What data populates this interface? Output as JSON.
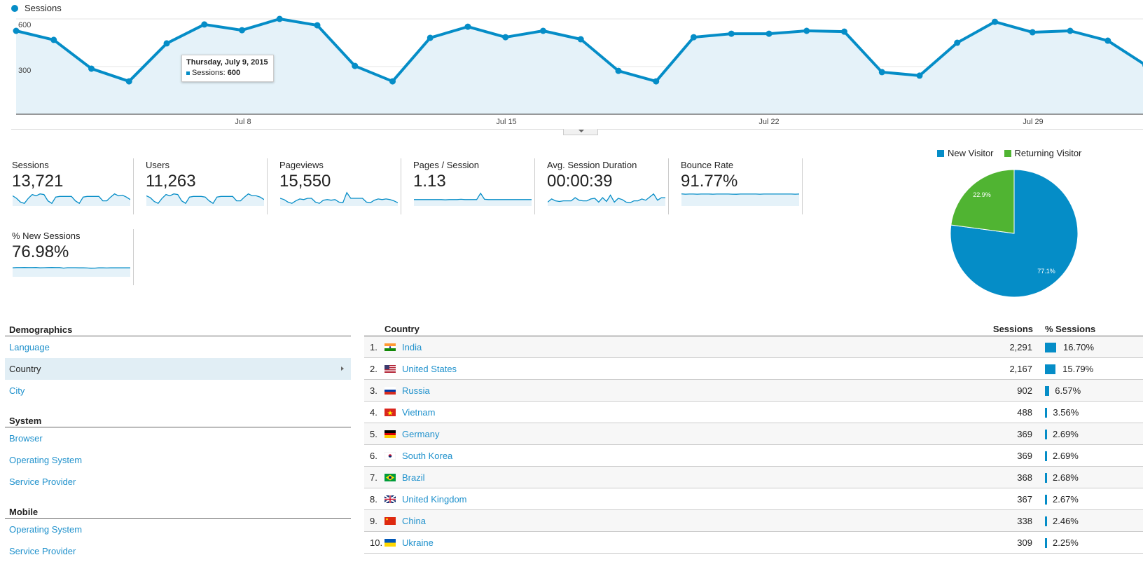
{
  "main_chart": {
    "legend_label": "Sessions",
    "y_ticks": [
      "600",
      "300"
    ],
    "x_ticks": [
      "Jul 8",
      "Jul 15",
      "Jul 22",
      "Jul 29"
    ],
    "tooltip": {
      "title": "Thursday, July 9, 2015",
      "metric": "Sessions:",
      "value": "600"
    }
  },
  "chart_data": [
    {
      "type": "area",
      "title": "Sessions",
      "x": [
        "Jul 2",
        "Jul 3",
        "Jul 4",
        "Jul 5",
        "Jul 6",
        "Jul 7",
        "Jul 8",
        "Jul 9",
        "Jul 10",
        "Jul 11",
        "Jul 12",
        "Jul 13",
        "Jul 14",
        "Jul 15",
        "Jul 16",
        "Jul 17",
        "Jul 18",
        "Jul 19",
        "Jul 20",
        "Jul 21",
        "Jul 22",
        "Jul 23",
        "Jul 24",
        "Jul 25",
        "Jul 26",
        "Jul 27",
        "Jul 28",
        "Jul 29",
        "Jul 30",
        "Jul 31",
        "Aug 1"
      ],
      "series": [
        {
          "name": "Sessions",
          "values": [
            525,
            468,
            287,
            207,
            446,
            565,
            529,
            600,
            560,
            304,
            207,
            481,
            551,
            485,
            525,
            472,
            273,
            207,
            485,
            507,
            507,
            525,
            520,
            265,
            243,
            450,
            582,
            516,
            525,
            463,
            310
          ]
        }
      ],
      "yticks": [
        300,
        600
      ],
      "ylim": [
        0,
        720
      ],
      "xtick_labels": [
        "Jul 8",
        "Jul 15",
        "Jul 22",
        "Jul 29"
      ],
      "grid": true,
      "legend": "top-left",
      "color": "#058dc7"
    },
    {
      "type": "pie",
      "title": "",
      "labels": [
        "New Visitor",
        "Returning Visitor"
      ],
      "values": [
        77.1,
        22.9
      ],
      "value_labels": [
        "77.1%",
        "22.9%"
      ],
      "colors": [
        "#058dc7",
        "#50b432"
      ],
      "legend": "top"
    }
  ],
  "metrics": [
    {
      "label": "Sessions",
      "value": "13,721",
      "spark": [
        0.7,
        0.5,
        0.2,
        0.1,
        0.5,
        0.8,
        0.7,
        0.85,
        0.8,
        0.3,
        0.1,
        0.6,
        0.65,
        0.65,
        0.65,
        0.65,
        0.3,
        0.1,
        0.6,
        0.65,
        0.65,
        0.65,
        0.65,
        0.3,
        0.3,
        0.6,
        0.85,
        0.7,
        0.75,
        0.6,
        0.4
      ]
    },
    {
      "label": "Users",
      "value": "11,263",
      "spark": [
        0.7,
        0.55,
        0.25,
        0.1,
        0.5,
        0.8,
        0.7,
        0.85,
        0.8,
        0.3,
        0.1,
        0.6,
        0.65,
        0.65,
        0.65,
        0.6,
        0.3,
        0.1,
        0.6,
        0.65,
        0.65,
        0.65,
        0.65,
        0.3,
        0.3,
        0.6,
        0.85,
        0.7,
        0.7,
        0.6,
        0.4
      ]
    },
    {
      "label": "Pageviews",
      "value": "15,550",
      "spark": [
        0.5,
        0.4,
        0.2,
        0.1,
        0.3,
        0.45,
        0.4,
        0.5,
        0.5,
        0.2,
        0.1,
        0.35,
        0.4,
        0.35,
        0.4,
        0.2,
        0.15,
        0.95,
        0.5,
        0.5,
        0.5,
        0.5,
        0.2,
        0.15,
        0.35,
        0.45,
        0.4,
        0.45,
        0.4,
        0.3,
        0.15
      ]
    },
    {
      "label": "Pages / Session",
      "value": "1.13",
      "spark": [
        0.4,
        0.4,
        0.4,
        0.4,
        0.4,
        0.4,
        0.4,
        0.4,
        0.38,
        0.4,
        0.4,
        0.4,
        0.42,
        0.4,
        0.4,
        0.4,
        0.4,
        0.9,
        0.42,
        0.4,
        0.4,
        0.4,
        0.4,
        0.4,
        0.4,
        0.4,
        0.4,
        0.4,
        0.4,
        0.4,
        0.4
      ]
    },
    {
      "label": "Avg. Session Duration",
      "value": "00:00:39",
      "spark": [
        0.2,
        0.45,
        0.3,
        0.25,
        0.3,
        0.3,
        0.3,
        0.55,
        0.35,
        0.3,
        0.3,
        0.45,
        0.5,
        0.2,
        0.55,
        0.25,
        0.75,
        0.2,
        0.5,
        0.4,
        0.2,
        0.15,
        0.3,
        0.3,
        0.45,
        0.35,
        0.6,
        0.85,
        0.35,
        0.55,
        0.55
      ]
    },
    {
      "label": "Bounce Rate",
      "value": "91.77%",
      "spark": [
        0.85,
        0.83,
        0.84,
        0.84,
        0.83,
        0.84,
        0.84,
        0.84,
        0.83,
        0.84,
        0.84,
        0.84,
        0.84,
        0.83,
        0.82,
        0.84,
        0.84,
        0.84,
        0.84,
        0.84,
        0.83,
        0.84,
        0.84,
        0.84,
        0.84,
        0.84,
        0.84,
        0.84,
        0.84,
        0.83,
        0.84
      ]
    },
    {
      "label": "% New Sessions",
      "value": "76.98%",
      "spark": [
        0.6,
        0.62,
        0.62,
        0.63,
        0.62,
        0.62,
        0.63,
        0.6,
        0.61,
        0.62,
        0.63,
        0.62,
        0.62,
        0.58,
        0.61,
        0.61,
        0.61,
        0.6,
        0.6,
        0.59,
        0.57,
        0.58,
        0.6,
        0.6,
        0.59,
        0.6,
        0.6,
        0.6,
        0.6,
        0.6,
        0.6
      ]
    }
  ],
  "pie_legend": [
    {
      "label": "New Visitor",
      "color": "#058dc7"
    },
    {
      "label": "Returning Visitor",
      "color": "#50b432"
    }
  ],
  "nav": {
    "sections": [
      {
        "title": "Demographics",
        "items": [
          {
            "label": "Language",
            "active": false
          },
          {
            "label": "Country",
            "active": true
          },
          {
            "label": "City",
            "active": false
          }
        ]
      },
      {
        "title": "System",
        "items": [
          {
            "label": "Browser",
            "active": false
          },
          {
            "label": "Operating System",
            "active": false
          },
          {
            "label": "Service Provider",
            "active": false
          }
        ]
      },
      {
        "title": "Mobile",
        "items": [
          {
            "label": "Operating System",
            "active": false
          },
          {
            "label": "Service Provider",
            "active": false
          }
        ]
      }
    ]
  },
  "table": {
    "headers": {
      "country": "Country",
      "sessions": "Sessions",
      "pct_sessions": "% Sessions"
    },
    "rows": [
      {
        "rank": "1.",
        "country": "India",
        "flag": "india-flag-icon",
        "sessions": "2,291",
        "pct": "16.70%",
        "pct_value": 16.7
      },
      {
        "rank": "2.",
        "country": "United States",
        "flag": "us-flag-icon",
        "sessions": "2,167",
        "pct": "15.79%",
        "pct_value": 15.79
      },
      {
        "rank": "3.",
        "country": "Russia",
        "flag": "russia-flag-icon",
        "sessions": "902",
        "pct": "6.57%",
        "pct_value": 6.57
      },
      {
        "rank": "4.",
        "country": "Vietnam",
        "flag": "vietnam-flag-icon",
        "sessions": "488",
        "pct": "3.56%",
        "pct_value": 3.56
      },
      {
        "rank": "5.",
        "country": "Germany",
        "flag": "germany-flag-icon",
        "sessions": "369",
        "pct": "2.69%",
        "pct_value": 2.69
      },
      {
        "rank": "6.",
        "country": "South Korea",
        "flag": "south-korea-flag-icon",
        "sessions": "369",
        "pct": "2.69%",
        "pct_value": 2.69
      },
      {
        "rank": "7.",
        "country": "Brazil",
        "flag": "brazil-flag-icon",
        "sessions": "368",
        "pct": "2.68%",
        "pct_value": 2.68
      },
      {
        "rank": "8.",
        "country": "United Kingdom",
        "flag": "uk-flag-icon",
        "sessions": "367",
        "pct": "2.67%",
        "pct_value": 2.67
      },
      {
        "rank": "9.",
        "country": "China",
        "flag": "china-flag-icon",
        "sessions": "338",
        "pct": "2.46%",
        "pct_value": 2.46
      },
      {
        "rank": "10.",
        "country": "Ukraine",
        "flag": "ukraine-flag-icon",
        "sessions": "309",
        "pct": "2.25%",
        "pct_value": 2.25
      }
    ]
  }
}
